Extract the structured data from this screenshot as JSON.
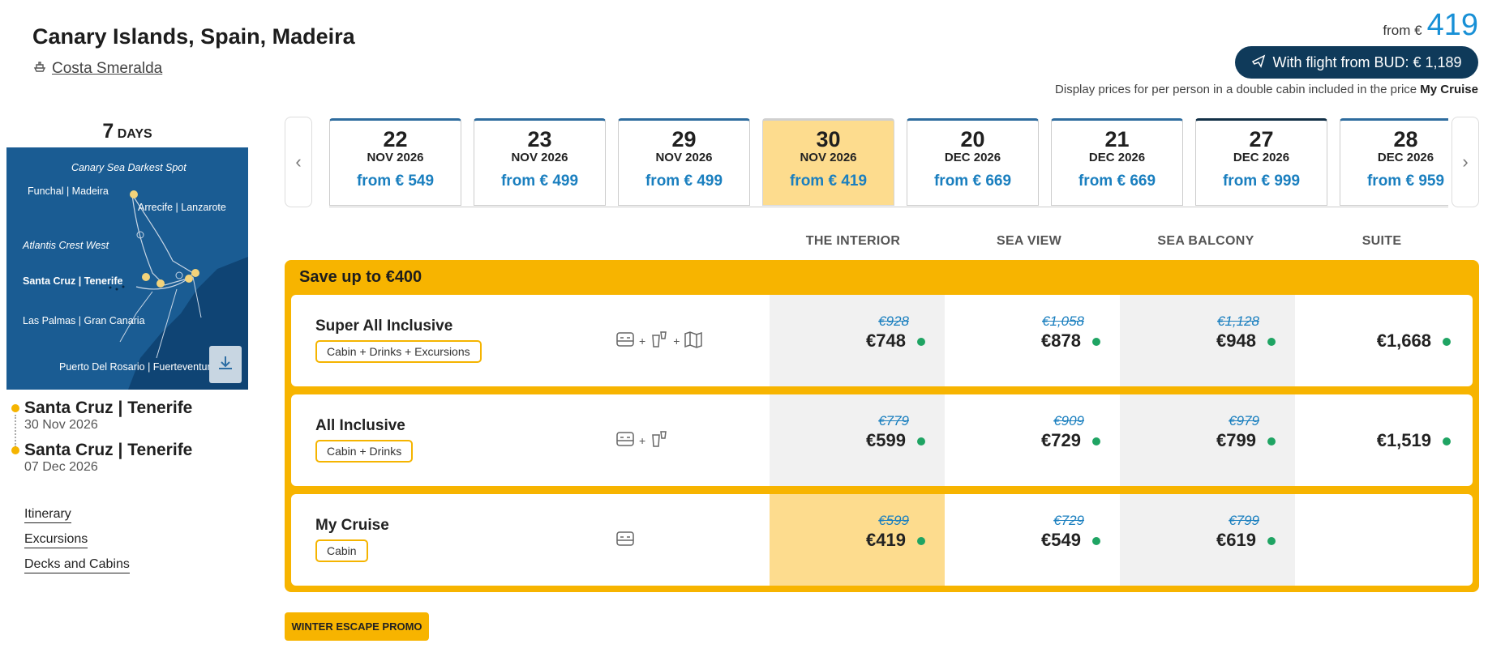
{
  "header": {
    "title": "Canary Islands, Spain, Madeira",
    "ship": "Costa Smeralda",
    "from_label": "from €",
    "from_price": "419",
    "flight_button": "With flight from BUD: € 1,189",
    "disclaimer_prefix": "Display prices for per person in a double cabin included in the price",
    "disclaimer_bold": "My Cruise"
  },
  "sidebar": {
    "days_number": "7",
    "days_label": "DAYS",
    "map_labels": [
      "Canary Sea Darkest Spot",
      "Funchal | Madeira",
      "Arrecife | Lanzarote",
      "Atlantis Crest West",
      "Santa Cruz | Tenerife",
      "Las Palmas | Gran Canaria",
      "Puerto Del Rosario | Fuerteventura"
    ],
    "route": [
      {
        "port": "Santa Cruz | Tenerife",
        "date": "30 Nov 2026"
      },
      {
        "port": "Santa Cruz | Tenerife",
        "date": "07 Dec 2026"
      }
    ],
    "links": [
      "Itinerary",
      "Excursions",
      "Decks and Cabins"
    ]
  },
  "dates": [
    {
      "day": "22",
      "month": "NOV 2026",
      "price": "from € 549"
    },
    {
      "day": "23",
      "month": "NOV 2026",
      "price": "from € 499"
    },
    {
      "day": "29",
      "month": "NOV 2026",
      "price": "from € 499"
    },
    {
      "day": "30",
      "month": "NOV 2026",
      "price": "from € 419"
    },
    {
      "day": "20",
      "month": "DEC 2026",
      "price": "from € 669"
    },
    {
      "day": "21",
      "month": "DEC 2026",
      "price": "from € 669"
    },
    {
      "day": "27",
      "month": "DEC 2026",
      "price": "from € 999"
    },
    {
      "day": "28",
      "month": "DEC 2026",
      "price": "from € 959"
    }
  ],
  "nav": {
    "prev": "‹",
    "next": "›"
  },
  "columns": [
    "THE INTERIOR",
    "SEA VIEW",
    "SEA BALCONY",
    "SUITE"
  ],
  "promo": {
    "title": "Save up to €400",
    "rows": [
      {
        "name": "Super All Inclusive",
        "badge": "Cabin + Drinks + Excursions",
        "prices": [
          {
            "old": "€928",
            "current": "€748"
          },
          {
            "old": "€1,058",
            "current": "€878"
          },
          {
            "old": "€1,128",
            "current": "€948"
          },
          {
            "old": "",
            "current": "€1,668"
          }
        ]
      },
      {
        "name": "All Inclusive",
        "badge": "Cabin + Drinks",
        "prices": [
          {
            "old": "€779",
            "current": "€599"
          },
          {
            "old": "€909",
            "current": "€729"
          },
          {
            "old": "€979",
            "current": "€799"
          },
          {
            "old": "",
            "current": "€1,519"
          }
        ]
      },
      {
        "name": "My Cruise",
        "badge": "Cabin",
        "prices": [
          {
            "old": "€599",
            "current": "€419"
          },
          {
            "old": "€729",
            "current": "€549"
          },
          {
            "old": "€799",
            "current": "€619"
          },
          {
            "old": "",
            "current": ""
          }
        ]
      }
    ]
  },
  "winter_promo": "WINTER ESCAPE PROMO",
  "colors": {
    "accent_yellow": "#f7b400",
    "selected_yellow": "#fddc8e",
    "link_blue": "#1a7fbf",
    "dark_navy": "#0f3a5a",
    "available_green": "#1fa463"
  }
}
